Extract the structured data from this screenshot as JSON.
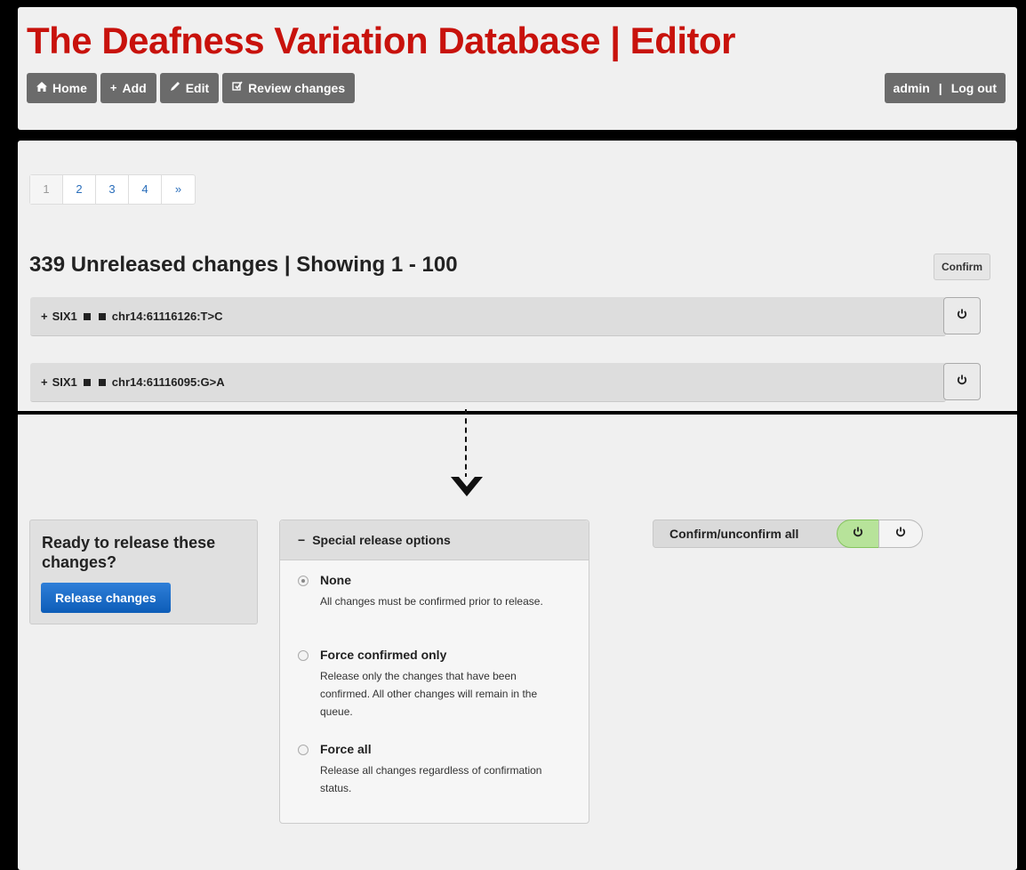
{
  "header": {
    "title": "The Deafness Variation Database | Editor",
    "nav": [
      {
        "icon": "home-icon",
        "glyph": "⌂",
        "label": "Home"
      },
      {
        "icon": "plus-icon",
        "glyph": "+",
        "label": "Add"
      },
      {
        "icon": "pencil-icon",
        "glyph": "╱",
        "label": "Edit"
      },
      {
        "icon": "edit-check-icon",
        "glyph": "☑",
        "label": "Review changes"
      }
    ],
    "user": "admin",
    "separator": "|",
    "logout": "Log out"
  },
  "pagination": {
    "pages": [
      "1",
      "2",
      "3",
      "4",
      "»"
    ],
    "current": "1"
  },
  "summary": {
    "heading": "339 Unreleased changes | Showing 1 - 100",
    "confirm_label": "Confirm"
  },
  "changes": [
    {
      "expander": "+",
      "gene": "SIX1",
      "variant": "chr14:61116126:T>C"
    },
    {
      "expander": "+",
      "gene": "SIX1",
      "variant": "chr14:61116095:G>A"
    }
  ],
  "release": {
    "question": "Ready to release these changes?",
    "button": "Release changes"
  },
  "special_options": {
    "collapse": "−",
    "title": "Special release options",
    "selected": "None",
    "options": [
      {
        "label": "None",
        "desc": "All changes must be confirmed prior to release."
      },
      {
        "label": "Force confirmed only",
        "desc": "Release only the changes that have been confirmed. All other changes will remain in the queue."
      },
      {
        "label": "Force all",
        "desc": "Release all changes regardless of confirmation status."
      }
    ]
  },
  "confirm_all": {
    "label": "Confirm/unconfirm all",
    "active_state": "on"
  },
  "colors": {
    "title_red": "#c8120c",
    "primary_blue": "#1565c0",
    "toggle_green": "#b7e39a",
    "nav_gray": "#6b6b6b"
  }
}
